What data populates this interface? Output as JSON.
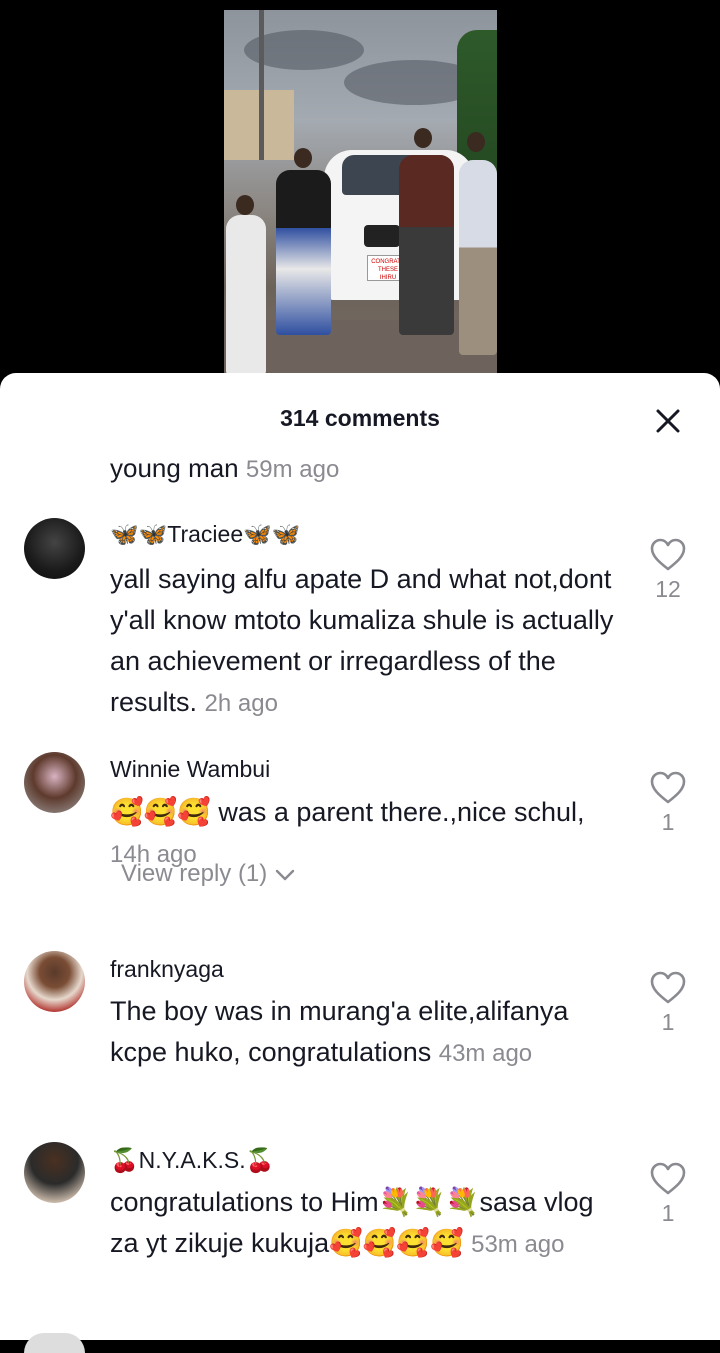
{
  "video": {
    "plate_text_line1": "CONGRATS",
    "plate_text_line2": "THESE",
    "plate_text_line3": "IHIRU"
  },
  "sheet": {
    "comments_count": "314 comments",
    "close_icon": "close-icon"
  },
  "partial_comment": {
    "text": "young man",
    "time": "59m ago"
  },
  "comments": [
    {
      "username": "🦋🦋Traciee🦋🦋",
      "text": "yall saying alfu apate D and what not,dont y'all know mtoto kumaliza shule is actually an achievement or irregardless of the results.",
      "time": "2h ago",
      "likes": "12"
    },
    {
      "username": "Winnie Wambui",
      "text": "🥰🥰🥰 was a parent there.,nice schul,",
      "time": "14h ago",
      "likes": "1",
      "view_reply": "View reply (1)"
    },
    {
      "username": "franknyaga",
      "text": "The boy was in murang'a elite,alifanya kcpe huko, congratulations",
      "time": "43m ago",
      "likes": "1"
    },
    {
      "username": "🍒N.Y.A.K.S.🍒",
      "text": "congratulations to Him💐💐💐sasa vlog za yt zikuje kukuja🥰🥰🥰🥰",
      "time": "53m ago",
      "likes": "1"
    }
  ],
  "colors": {
    "text": "#161823",
    "muted": "#8a8b91",
    "sheet_bg": "#ffffff"
  }
}
